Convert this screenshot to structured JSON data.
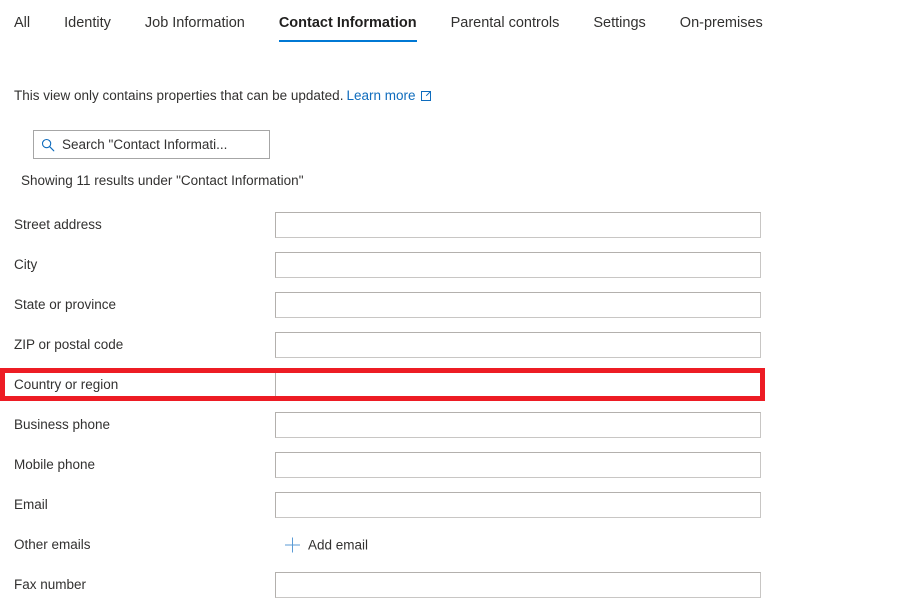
{
  "tabs": [
    {
      "label": "All",
      "active": false
    },
    {
      "label": "Identity",
      "active": false
    },
    {
      "label": "Job Information",
      "active": false
    },
    {
      "label": "Contact Information",
      "active": true
    },
    {
      "label": "Parental controls",
      "active": false
    },
    {
      "label": "Settings",
      "active": false
    },
    {
      "label": "On-premises",
      "active": false
    }
  ],
  "info": {
    "text": "This view only contains properties that can be updated.",
    "link_label": "Learn more",
    "link_icon": "external-link-icon"
  },
  "search": {
    "icon": "search-icon",
    "placeholder": "Search \"Contact Informati...",
    "value": ""
  },
  "results_text": "Showing 11 results under \"Contact Information\"",
  "fields": [
    {
      "label": "Street address",
      "value": "",
      "type": "input",
      "highlighted": false
    },
    {
      "label": "City",
      "value": "",
      "type": "input",
      "highlighted": false
    },
    {
      "label": "State or province",
      "value": "",
      "type": "input",
      "highlighted": false
    },
    {
      "label": "ZIP or postal code",
      "value": "",
      "type": "input",
      "highlighted": false
    },
    {
      "label": "Country or region",
      "value": "",
      "type": "input",
      "highlighted": true
    },
    {
      "label": "Business phone",
      "value": "",
      "type": "input",
      "highlighted": false
    },
    {
      "label": "Mobile phone",
      "value": "",
      "type": "input",
      "highlighted": false
    },
    {
      "label": "Email",
      "value": "",
      "type": "input",
      "highlighted": false
    },
    {
      "label": "Other emails",
      "value": "",
      "type": "action",
      "action_label": "Add email",
      "action_icon": "plus-icon",
      "highlighted": false
    },
    {
      "label": "Fax number",
      "value": "",
      "type": "input",
      "highlighted": false
    }
  ],
  "colors": {
    "accent": "#0078d4",
    "link": "#0f6cbd",
    "highlight": "#ed1c24",
    "text": "#323130",
    "field_border": "#b3b0ad"
  }
}
